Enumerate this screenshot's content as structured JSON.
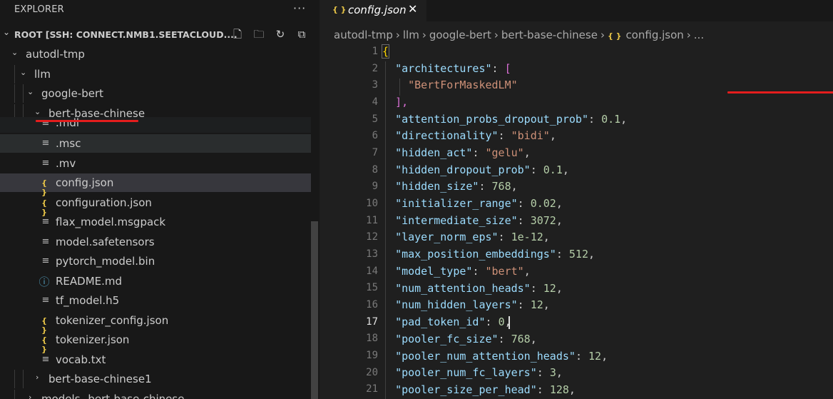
{
  "explorer": {
    "title": "EXPLORER",
    "more_icon": "ellipsis-icon",
    "root_label": "ROOT [SSH: CONNECT.NMB1.SEETACLOUD....",
    "actions": [
      "new-file-icon",
      "new-folder-icon",
      "refresh-icon",
      "collapse-all-icon"
    ]
  },
  "tree": {
    "autodl_tmp": "autodl-tmp",
    "llm": "llm",
    "google_bert": "google-bert",
    "bert_base_chinese": "bert-base-chinese",
    "files": [
      ".mdl",
      ".msc",
      ".mv",
      "config.json",
      "configuration.json",
      "flax_model.msgpack",
      "model.safetensors",
      "pytorch_model.bin",
      "README.md",
      "tf_model.h5",
      "tokenizer_config.json",
      "tokenizer.json",
      "vocab.txt"
    ],
    "bert_base_chinese1": "bert-base-chinese1",
    "models_partial": "models--bert-base-chinese"
  },
  "tab": {
    "label": "config.json",
    "close_icon": "close-icon"
  },
  "breadcrumb": {
    "items": [
      "autodl-tmp",
      "llm",
      "google-bert",
      "bert-base-chinese",
      "config.json",
      "..."
    ]
  },
  "editor": {
    "active_line": 17,
    "line_numbers": [
      "1",
      "2",
      "3",
      "4",
      "5",
      "6",
      "7",
      "8",
      "9",
      "10",
      "11",
      "12",
      "13",
      "14",
      "15",
      "16",
      "17",
      "18",
      "19",
      "20",
      "21"
    ],
    "lines": {
      "l2": {
        "key": "\"architectures\"",
        "open": "["
      },
      "l3": {
        "str": "\"BertForMaskedLM\""
      },
      "l4": {
        "close": "],"
      },
      "l5": {
        "key": "\"attention_probs_dropout_prob\"",
        "num": "0.1"
      },
      "l6": {
        "key": "\"directionality\"",
        "str": "\"bidi\""
      },
      "l7": {
        "key": "\"hidden_act\"",
        "str": "\"gelu\""
      },
      "l8": {
        "key": "\"hidden_dropout_prob\"",
        "num": "0.1"
      },
      "l9": {
        "key": "\"hidden_size\"",
        "num": "768"
      },
      "l10": {
        "key": "\"initializer_range\"",
        "num": "0.02"
      },
      "l11": {
        "key": "\"intermediate_size\"",
        "num": "3072"
      },
      "l12": {
        "key": "\"layer_norm_eps\"",
        "num": "1e-12"
      },
      "l13": {
        "key": "\"max_position_embeddings\"",
        "num": "512"
      },
      "l14": {
        "key": "\"model_type\"",
        "str": "\"bert\""
      },
      "l15": {
        "key": "\"num_attention_heads\"",
        "num": "12"
      },
      "l16": {
        "key": "\"num_hidden_layers\"",
        "num": "12"
      },
      "l17": {
        "key": "\"pad_token_id\"",
        "num": "0"
      },
      "l18": {
        "key": "\"pooler_fc_size\"",
        "num": "768"
      },
      "l19": {
        "key": "\"pooler_num_attention_heads\"",
        "num": "12"
      },
      "l20": {
        "key": "\"pooler_num_fc_layers\"",
        "num": "3"
      },
      "l21": {
        "key": "\"pooler_size_per_head\"",
        "num": "128"
      }
    }
  },
  "colors": {
    "annotation_red": "#e41d1d",
    "json_icon": "#e8c547",
    "key": "#9cdcfe",
    "string": "#ce9178",
    "number": "#b5cea8"
  }
}
